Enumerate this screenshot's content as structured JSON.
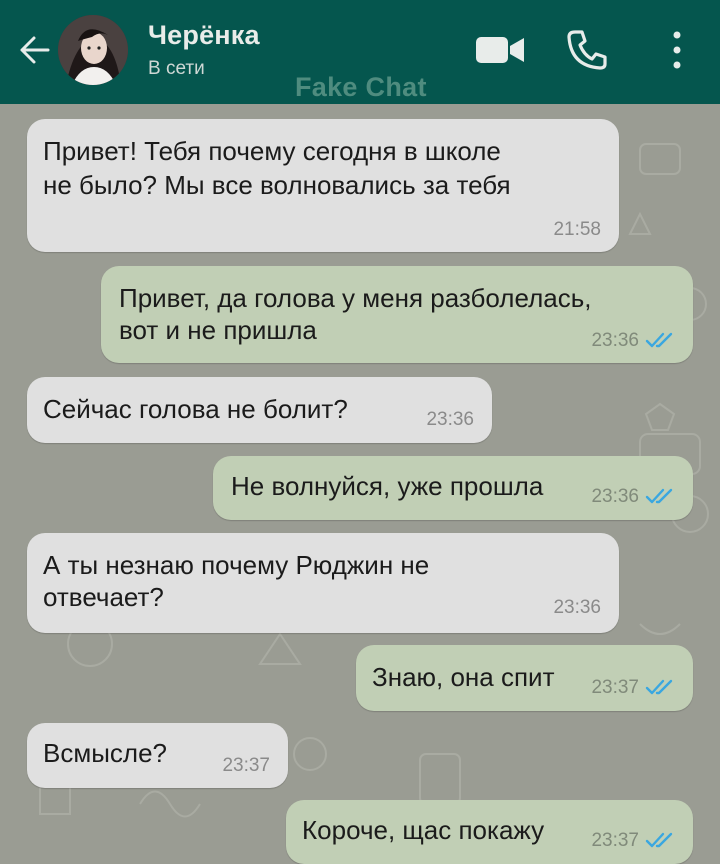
{
  "header": {
    "contact_name": "Черёнка",
    "status": "В сети",
    "watermark": "Fake Chat"
  },
  "icons": {
    "back": "arrow-left-icon",
    "video": "video-camera-icon",
    "call": "phone-icon",
    "menu": "more-vertical-icon",
    "read_receipt": "double-check-icon"
  },
  "colors": {
    "header": "#05564e",
    "incoming_bubble": "#e0e0e0",
    "outgoing_bubble": "#c1cfb5",
    "read_ticks": "#3aa7e0"
  },
  "messages": [
    {
      "direction": "incoming",
      "lines": [
        "Привет! Тебя почему сегодня в школе",
        "не было? Мы все волновались за тебя"
      ],
      "time": "21:58"
    },
    {
      "direction": "outgoing",
      "lines": [
        "Привет, да голова у меня разболелась,",
        "вот и не пришла"
      ],
      "time": "23:36"
    },
    {
      "direction": "incoming",
      "lines": [
        "Сейчас голова не болит?"
      ],
      "time": "23:36"
    },
    {
      "direction": "outgoing",
      "lines": [
        "Не волнуйся, уже прошла"
      ],
      "time": "23:36"
    },
    {
      "direction": "incoming",
      "lines": [
        "А ты незнаю почему Рюджин не",
        "отвечает?"
      ],
      "time": "23:36"
    },
    {
      "direction": "outgoing",
      "lines": [
        "Знаю, она спит"
      ],
      "time": "23:37"
    },
    {
      "direction": "incoming",
      "lines": [
        "Всмысле?"
      ],
      "time": "23:37"
    },
    {
      "direction": "outgoing",
      "lines": [
        "Короче, щас покажу"
      ],
      "time": "23:37"
    }
  ]
}
